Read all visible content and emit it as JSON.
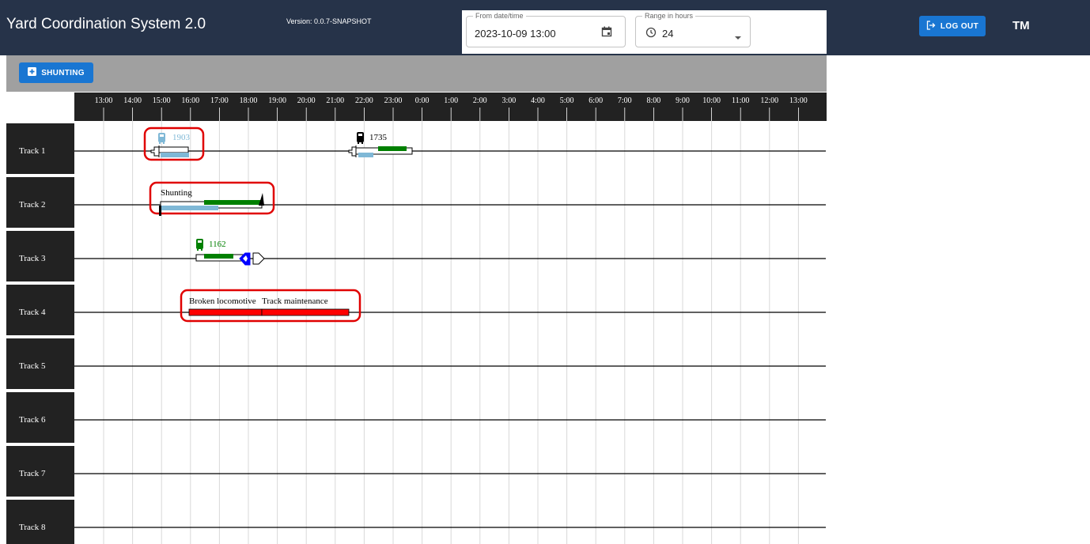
{
  "app": {
    "title": "Yard Coordination System 2.0",
    "version": "Version: 0.0.7-SNAPSHOT",
    "user_initials": "TM"
  },
  "filters": {
    "from_label": "From date/time",
    "from_value": "2023-10-09 13:00",
    "range_label": "Range in hours",
    "range_value": "24"
  },
  "buttons": {
    "logout": "LOG OUT",
    "shunting": "SHUNTING"
  },
  "colors": {
    "header_bg": "#263349",
    "primary": "#1976d2",
    "toolbar_bg": "#a0a0a0",
    "track_label_bg": "#222222",
    "green": "#008000",
    "light_blue": "#7fb8d6",
    "red": "#ff0000",
    "blue": "#0000ff",
    "highlight": "#e00000"
  },
  "icons": {
    "calendar": "calendar-icon",
    "clock": "clock-icon",
    "dropdown": "chevron-down-icon",
    "logout": "logout-icon",
    "add": "add-box-icon",
    "locomotive": "locomotive-icon"
  },
  "timeline": {
    "hours": [
      "13:00",
      "14:00",
      "15:00",
      "16:00",
      "17:00",
      "18:00",
      "19:00",
      "20:00",
      "21:00",
      "22:00",
      "23:00",
      "0:00",
      "1:00",
      "2:00",
      "3:00",
      "4:00",
      "5:00",
      "6:00",
      "7:00",
      "8:00",
      "9:00",
      "10:00",
      "11:00",
      "12:00",
      "13:00"
    ],
    "tracks": [
      "Track 1",
      "Track 2",
      "Track 3",
      "Track 4",
      "Track 5",
      "Track 6",
      "Track 7",
      "Track 8"
    ]
  },
  "events": {
    "loco_1903": "1903",
    "loco_1735": "1735",
    "shunting": "Shunting",
    "loco_1162": "1162",
    "broken_loco": "Broken locomotive",
    "track_maint": "Track maintenance"
  }
}
